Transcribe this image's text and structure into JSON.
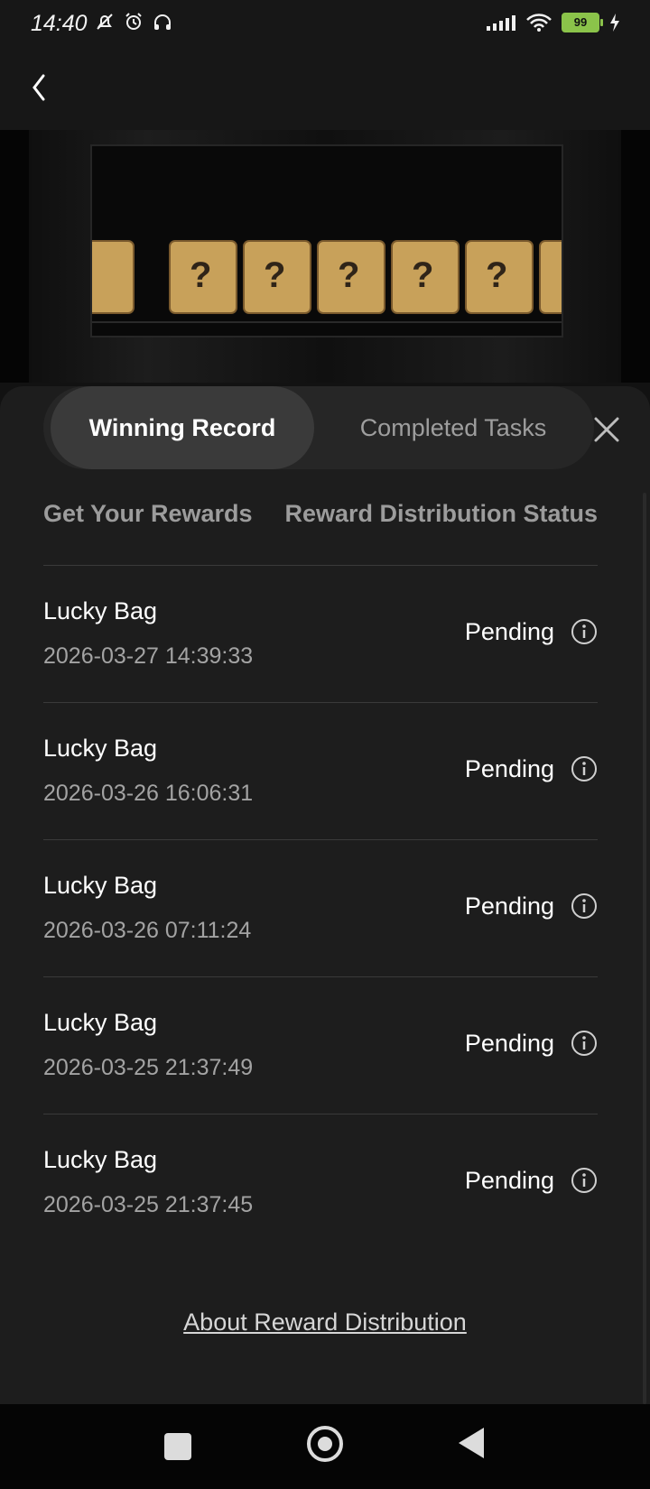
{
  "status_bar": {
    "time": "14:40",
    "battery": "99",
    "icons": [
      "muted-bell-icon",
      "alarm-icon",
      "headphones-icon",
      "signal-icon",
      "wifi-icon",
      "battery-icon",
      "charging-icon"
    ]
  },
  "header": {
    "back_icon": "chevron-left-icon"
  },
  "tabs": [
    {
      "label": "Winning Record",
      "active": true
    },
    {
      "label": "Completed Tasks",
      "active": false
    }
  ],
  "columns": {
    "left": "Get Your Rewards",
    "right": "Reward Distribution Status"
  },
  "records": [
    {
      "title": "Lucky Bag",
      "date": "2026-03-27 14:39:33",
      "status": "Pending"
    },
    {
      "title": "Lucky Bag",
      "date": "2026-03-26 16:06:31",
      "status": "Pending"
    },
    {
      "title": "Lucky Bag",
      "date": "2026-03-26 07:11:24",
      "status": "Pending"
    },
    {
      "title": "Lucky Bag",
      "date": "2026-03-25 21:37:49",
      "status": "Pending"
    },
    {
      "title": "Lucky Bag",
      "date": "2026-03-25 21:37:45",
      "status": "Pending"
    }
  ],
  "footer": {
    "about_link": "About Reward Distribution"
  },
  "colors": {
    "sheet_bg": "#1d1d1d",
    "active_tab_bg": "#3a3a3a",
    "battery_green": "#8bc34a"
  }
}
